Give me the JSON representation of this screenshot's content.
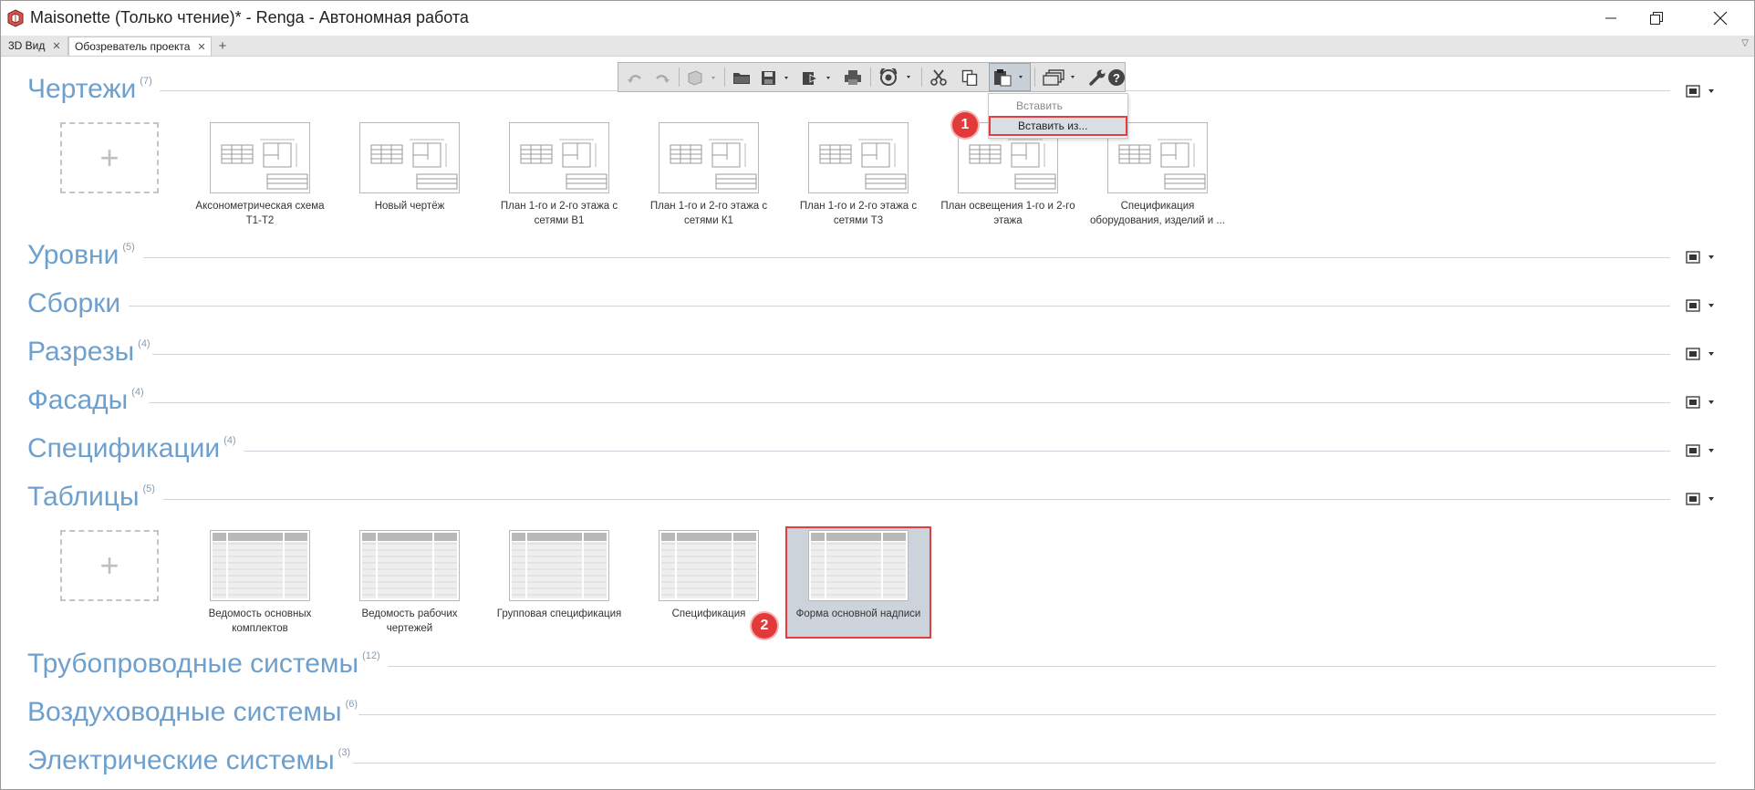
{
  "window": {
    "title": "Maisonette (Только чтение)* - Renga - Автономная работа",
    "buttons": [
      "minimize",
      "restore",
      "close"
    ]
  },
  "tabs": [
    {
      "label": "3D Вид",
      "active": false
    },
    {
      "label": "Обозреватель проекта",
      "active": true
    }
  ],
  "toolbar": {
    "buttons": [
      "undo-icon",
      "redo-icon",
      "view-3d-icon",
      "open-folder-icon",
      "save-icon",
      "export-icon",
      "print-icon",
      "cloud-sync-icon",
      "cut-icon",
      "copy-icon",
      "paste-icon",
      "layers-icon",
      "wrench-icon",
      "help-icon"
    ]
  },
  "paste_menu": {
    "items": [
      {
        "label": "Вставить",
        "enabled": false
      },
      {
        "label": "Вставить из...",
        "enabled": true,
        "highlighted": true
      }
    ]
  },
  "annotations": {
    "badge1": "1",
    "badge2": "2"
  },
  "sections": {
    "drawings": {
      "title": "Чертежи",
      "count": "(7)",
      "items": [
        "Аксонометрическая схема Т1-Т2",
        "Новый чертёж",
        "План 1-го и 2-го этажа с сетями В1",
        "План 1-го и 2-го этажа с сетями К1",
        "План 1-го и 2-го этажа с сетями Т3",
        "План освещения 1-го и 2-го этажа",
        "Спецификация оборудования, изделий и ..."
      ]
    },
    "levels": {
      "title": "Уровни",
      "count": "(5)"
    },
    "assemblies": {
      "title": "Сборки",
      "count": ""
    },
    "sections": {
      "title": "Разрезы",
      "count": "(4)"
    },
    "facades": {
      "title": "Фасады",
      "count": "(4)"
    },
    "specifications": {
      "title": "Спецификации",
      "count": "(4)"
    },
    "tables": {
      "title": "Таблицы",
      "count": "(5)",
      "items": [
        "Ведомость основных комплектов",
        "Ведомость рабочих чертежей",
        "Групповая спецификация",
        "Спецификация",
        "Форма основной надписи"
      ],
      "selected": "Форма основной надписи"
    },
    "pipe_systems": {
      "title": "Трубопроводные системы",
      "count": "(12)"
    },
    "duct_systems": {
      "title": "Воздуховодные системы",
      "count": "(6)"
    },
    "electric_systems": {
      "title": "Электрические системы",
      "count": "(3)"
    }
  },
  "colors": {
    "section_title": "#6ea0ce",
    "highlight": "#e53d3d",
    "selection_bg": "#cdd3da"
  }
}
